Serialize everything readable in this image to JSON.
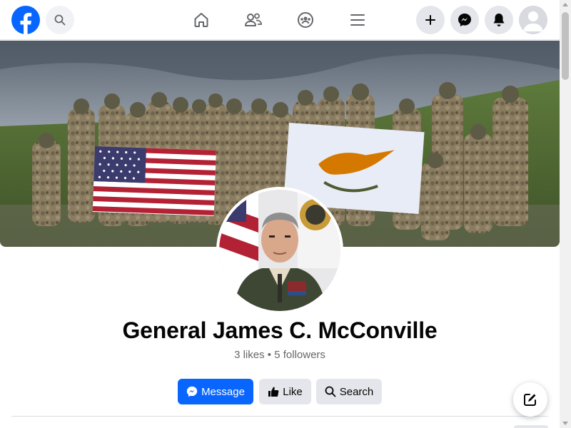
{
  "brand": {
    "accent": "#0866ff",
    "logo": "facebook-logo-icon"
  },
  "topbar": {
    "search_icon": "search-icon",
    "nav": [
      {
        "name": "home-icon"
      },
      {
        "name": "friends-icon"
      },
      {
        "name": "groups-icon"
      },
      {
        "name": "menu-icon"
      }
    ],
    "actions": [
      {
        "name": "plus-icon"
      },
      {
        "name": "messenger-icon"
      },
      {
        "name": "bell-icon"
      }
    ]
  },
  "profile": {
    "name": "General James C. McConville",
    "likes": "3 likes",
    "separator": "•",
    "followers": "5 followers"
  },
  "actions": {
    "message_label": "Message",
    "like_label": "Like",
    "search_label": "Search"
  }
}
